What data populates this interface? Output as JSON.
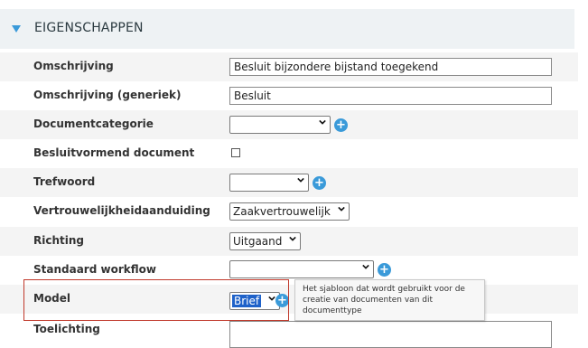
{
  "section": {
    "title": "EIGENSCHAPPEN",
    "accent": "#3a9ad9"
  },
  "rows": {
    "omschrijving": {
      "label": "Omschrijving",
      "value": "Besluit bijzondere bijstand toegekend"
    },
    "omschrijving_generiek": {
      "label": "Omschrijving (generiek)",
      "value": "Besluit"
    },
    "documentcategorie": {
      "label": "Documentcategorie",
      "value": ""
    },
    "besluitvormend": {
      "label": "Besluitvormend document",
      "checked": false
    },
    "trefwoord": {
      "label": "Trefwoord",
      "value": ""
    },
    "vertrouwelijkheid": {
      "label": "Vertrouwelijkheidaanduiding",
      "value": "Zaakvertrouwelijk"
    },
    "richting": {
      "label": "Richting",
      "value": "Uitgaand"
    },
    "standaard_workflow": {
      "label": "Standaard workflow",
      "value": ""
    },
    "model": {
      "label": "Model",
      "value": "Brief"
    },
    "toelichting": {
      "label": "Toelichting",
      "value": ""
    }
  },
  "tooltip": {
    "text": "Het sjabloon dat wordt gebruikt voor de creatie van documenten van dit documenttype"
  },
  "icons": {
    "add": "+",
    "expand": "triangle-down"
  },
  "colors": {
    "highlight_border": "#c0392b",
    "selected_bg": "#1f62c9"
  }
}
